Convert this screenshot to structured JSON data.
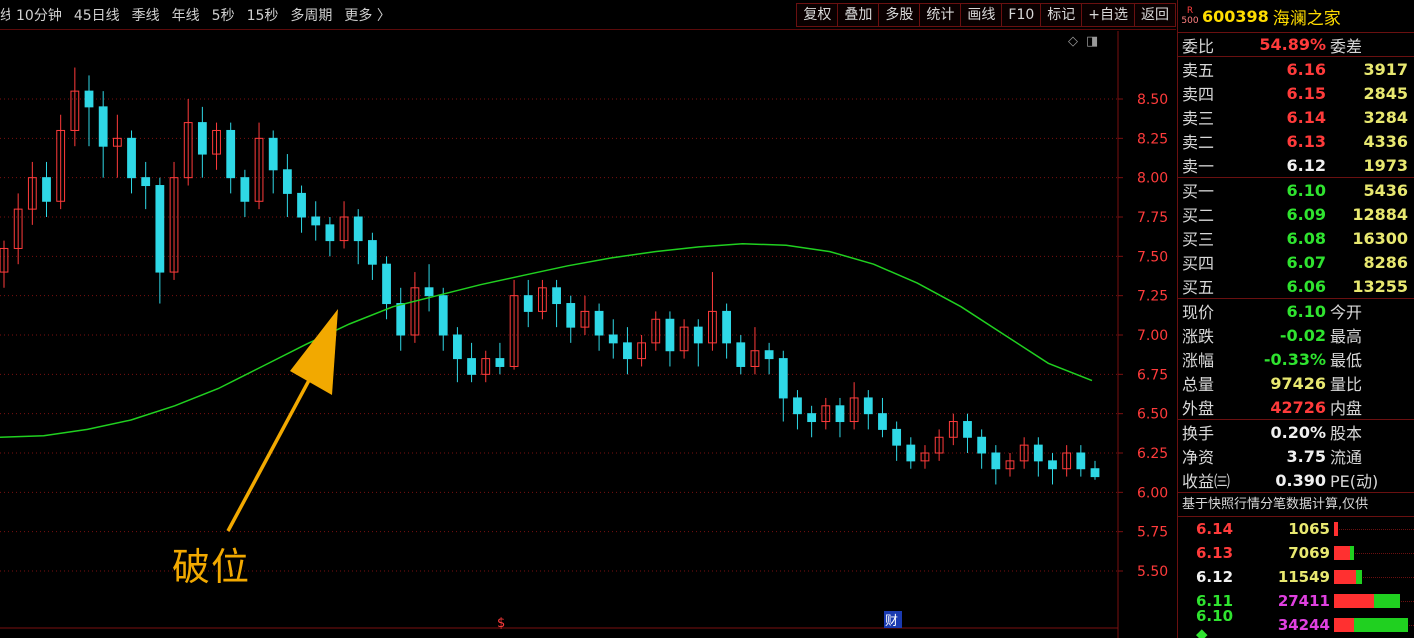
{
  "toolbar": {
    "period_tabs": [
      "线",
      "10分钟",
      "45日线",
      "季线",
      "年线",
      "5秒",
      "15秒",
      "多周期",
      "更多 〉"
    ],
    "buttons": [
      "复权",
      "叠加",
      "多股",
      "统计",
      "画线",
      "F10",
      "标记",
      "+自选",
      "返回"
    ]
  },
  "chart_icons": {
    "diamond": "◇",
    "panel": "◨"
  },
  "annotation": {
    "text": "破位",
    "color": "#f2a900"
  },
  "markers": {
    "left": "$",
    "right": "财"
  },
  "colors": {
    "up": "#ff3b3b",
    "down": "#2fd8e6",
    "ma": "#20d020",
    "grid": "#7a1010",
    "axis_label": "#ff3b3b"
  },
  "chart_data": {
    "type": "candlestick",
    "y_ticks": [
      "8.50",
      "8.25",
      "8.00",
      "7.75",
      "7.50",
      "7.25",
      "7.00",
      "6.75",
      "6.50",
      "6.25",
      "6.00",
      "5.75",
      "5.50"
    ],
    "ylim": [
      5.3,
      8.8
    ],
    "ma_line": [
      6.35,
      6.36,
      6.4,
      6.46,
      6.55,
      6.66,
      6.8,
      6.94,
      7.07,
      7.18,
      7.25,
      7.32,
      7.38,
      7.44,
      7.49,
      7.53,
      7.56,
      7.58,
      7.57,
      7.53,
      7.45,
      7.33,
      7.18,
      7.0,
      6.82,
      6.71
    ],
    "candles": [
      [
        7.4,
        7.55,
        7.3,
        7.6
      ],
      [
        7.55,
        7.8,
        7.45,
        7.9
      ],
      [
        7.8,
        8.0,
        7.7,
        8.1
      ],
      [
        8.0,
        7.85,
        7.75,
        8.1
      ],
      [
        7.85,
        8.3,
        7.8,
        8.4
      ],
      [
        8.3,
        8.55,
        8.2,
        8.7
      ],
      [
        8.55,
        8.45,
        8.2,
        8.65
      ],
      [
        8.45,
        8.2,
        8.0,
        8.55
      ],
      [
        8.2,
        8.25,
        8.0,
        8.4
      ],
      [
        8.25,
        8.0,
        7.9,
        8.3
      ],
      [
        8.0,
        7.95,
        7.8,
        8.1
      ],
      [
        7.95,
        7.4,
        7.2,
        8.0
      ],
      [
        7.4,
        8.0,
        7.35,
        8.1
      ],
      [
        8.0,
        8.35,
        7.95,
        8.5
      ],
      [
        8.35,
        8.15,
        8.0,
        8.45
      ],
      [
        8.15,
        8.3,
        8.05,
        8.35
      ],
      [
        8.3,
        8.0,
        7.9,
        8.35
      ],
      [
        8.0,
        7.85,
        7.75,
        8.05
      ],
      [
        7.85,
        8.25,
        7.8,
        8.35
      ],
      [
        8.25,
        8.05,
        7.9,
        8.3
      ],
      [
        8.05,
        7.9,
        7.75,
        8.15
      ],
      [
        7.9,
        7.75,
        7.65,
        7.95
      ],
      [
        7.75,
        7.7,
        7.6,
        7.85
      ],
      [
        7.7,
        7.6,
        7.5,
        7.75
      ],
      [
        7.6,
        7.75,
        7.55,
        7.85
      ],
      [
        7.75,
        7.6,
        7.45,
        7.8
      ],
      [
        7.6,
        7.45,
        7.35,
        7.65
      ],
      [
        7.45,
        7.2,
        7.1,
        7.5
      ],
      [
        7.2,
        7.0,
        6.9,
        7.3
      ],
      [
        7.0,
        7.3,
        6.95,
        7.4
      ],
      [
        7.3,
        7.25,
        7.15,
        7.45
      ],
      [
        7.25,
        7.0,
        6.9,
        7.3
      ],
      [
        7.0,
        6.85,
        6.7,
        7.05
      ],
      [
        6.85,
        6.75,
        6.7,
        6.95
      ],
      [
        6.75,
        6.85,
        6.7,
        6.9
      ],
      [
        6.85,
        6.8,
        6.75,
        6.95
      ],
      [
        6.8,
        7.25,
        6.78,
        7.35
      ],
      [
        7.25,
        7.15,
        7.05,
        7.35
      ],
      [
        7.15,
        7.3,
        7.1,
        7.35
      ],
      [
        7.3,
        7.2,
        7.05,
        7.35
      ],
      [
        7.2,
        7.05,
        6.95,
        7.25
      ],
      [
        7.05,
        7.15,
        7.0,
        7.25
      ],
      [
        7.15,
        7.0,
        6.9,
        7.2
      ],
      [
        7.0,
        6.95,
        6.85,
        7.1
      ],
      [
        6.95,
        6.85,
        6.75,
        7.05
      ],
      [
        6.85,
        6.95,
        6.8,
        7.0
      ],
      [
        6.95,
        7.1,
        6.9,
        7.15
      ],
      [
        7.1,
        6.9,
        6.8,
        7.15
      ],
      [
        6.9,
        7.05,
        6.85,
        7.1
      ],
      [
        7.05,
        6.95,
        6.8,
        7.1
      ],
      [
        6.95,
        7.15,
        6.9,
        7.4
      ],
      [
        7.15,
        6.95,
        6.85,
        7.2
      ],
      [
        6.95,
        6.8,
        6.75,
        7.0
      ],
      [
        6.8,
        6.9,
        6.75,
        7.05
      ],
      [
        6.9,
        6.85,
        6.75,
        6.95
      ],
      [
        6.85,
        6.6,
        6.45,
        6.9
      ],
      [
        6.6,
        6.5,
        6.4,
        6.65
      ],
      [
        6.5,
        6.45,
        6.35,
        6.55
      ],
      [
        6.45,
        6.55,
        6.4,
        6.6
      ],
      [
        6.55,
        6.45,
        6.35,
        6.6
      ],
      [
        6.45,
        6.6,
        6.4,
        6.7
      ],
      [
        6.6,
        6.5,
        6.4,
        6.65
      ],
      [
        6.5,
        6.4,
        6.35,
        6.6
      ],
      [
        6.4,
        6.3,
        6.2,
        6.45
      ],
      [
        6.3,
        6.2,
        6.15,
        6.35
      ],
      [
        6.2,
        6.25,
        6.15,
        6.3
      ],
      [
        6.25,
        6.35,
        6.2,
        6.4
      ],
      [
        6.35,
        6.45,
        6.3,
        6.5
      ],
      [
        6.45,
        6.35,
        6.25,
        6.5
      ],
      [
        6.35,
        6.25,
        6.15,
        6.4
      ],
      [
        6.25,
        6.15,
        6.05,
        6.3
      ],
      [
        6.15,
        6.2,
        6.1,
        6.25
      ],
      [
        6.2,
        6.3,
        6.15,
        6.35
      ],
      [
        6.3,
        6.2,
        6.1,
        6.35
      ],
      [
        6.2,
        6.15,
        6.05,
        6.25
      ],
      [
        6.15,
        6.25,
        6.1,
        6.3
      ],
      [
        6.25,
        6.15,
        6.1,
        6.3
      ],
      [
        6.15,
        6.1,
        6.08,
        6.2
      ]
    ]
  },
  "panel": {
    "badge_top": "R",
    "badge_bottom": "500",
    "code": "600398",
    "name": "海澜之家",
    "weibi": {
      "label": "委比",
      "value": "54.89%",
      "label2": "委差"
    },
    "sell": [
      {
        "label": "卖五",
        "price": "6.16",
        "vol": "3917"
      },
      {
        "label": "卖四",
        "price": "6.15",
        "vol": "2845"
      },
      {
        "label": "卖三",
        "price": "6.14",
        "vol": "3284"
      },
      {
        "label": "卖二",
        "price": "6.13",
        "vol": "4336"
      },
      {
        "label": "卖一",
        "price": "6.12",
        "vol": "1973"
      }
    ],
    "buy": [
      {
        "label": "买一",
        "price": "6.10",
        "vol": "5436"
      },
      {
        "label": "买二",
        "price": "6.09",
        "vol": "12884"
      },
      {
        "label": "买三",
        "price": "6.08",
        "vol": "16300"
      },
      {
        "label": "买四",
        "price": "6.07",
        "vol": "8286"
      },
      {
        "label": "买五",
        "price": "6.06",
        "vol": "13255"
      }
    ],
    "quote": [
      {
        "label": "现价",
        "value": "6.10",
        "label2": "今开"
      },
      {
        "label": "涨跌",
        "value": "-0.02",
        "label2": "最高"
      },
      {
        "label": "涨幅",
        "value": "-0.33%",
        "label2": "最低"
      },
      {
        "label": "总量",
        "value": "97426",
        "label2": "量比"
      },
      {
        "label": "外盘",
        "value": "42726",
        "label2": "内盘"
      }
    ],
    "info": [
      {
        "label": "换手",
        "value": "0.20%",
        "label2": "股本"
      },
      {
        "label": "净资",
        "value": "3.75",
        "label2": "流通"
      },
      {
        "label": "收益㈢",
        "value": "0.390",
        "label2": "PE(动)"
      }
    ],
    "note": "基于快照行情分笔数据计算,仅供",
    "trades": [
      {
        "price": "6.14",
        "vol": "1065",
        "red": 4,
        "green": 0
      },
      {
        "price": "6.13",
        "vol": "7069",
        "red": 16,
        "green": 4
      },
      {
        "price": "6.12",
        "vol": "11549",
        "red": 22,
        "green": 6
      },
      {
        "price": "6.11",
        "vol": "27411",
        "red": 40,
        "green": 26
      },
      {
        "price": "6.10 ◆",
        "vol": "34244",
        "red": 20,
        "green": 54
      }
    ]
  }
}
